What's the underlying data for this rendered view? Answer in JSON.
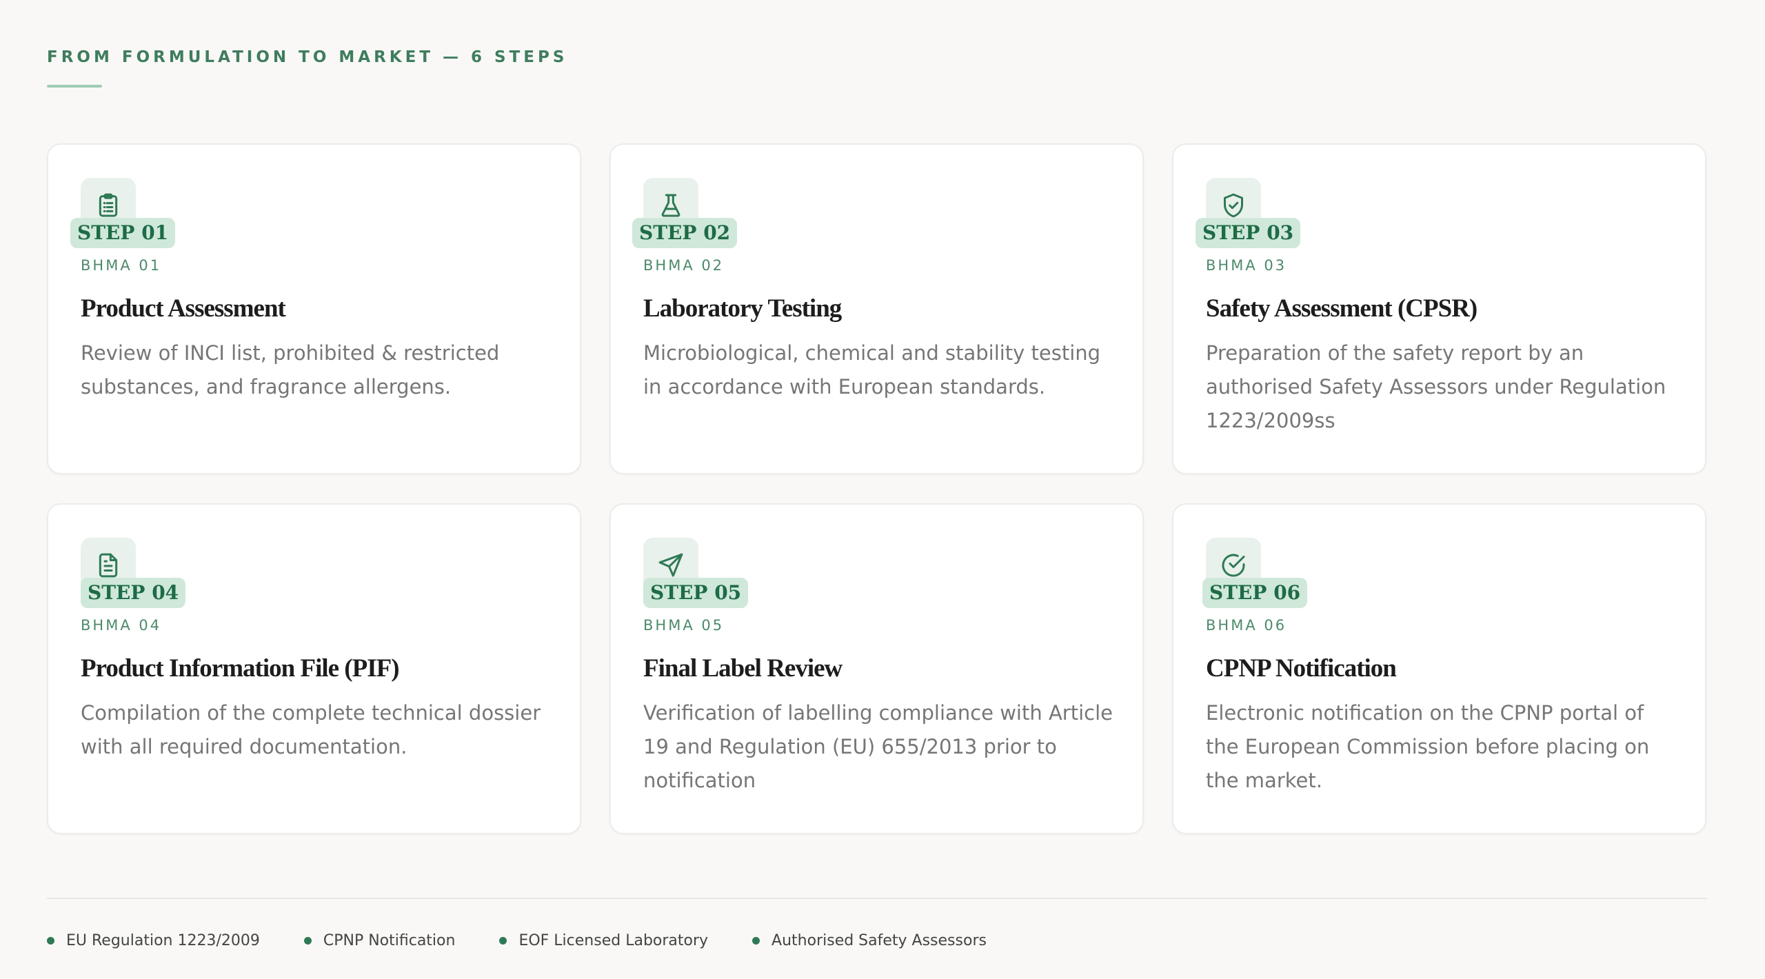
{
  "header": {
    "eyebrow": "FROM FORMULATION TO MARKET — 6 STEPS"
  },
  "colors": {
    "accent": "#2f7a55",
    "badge_bg": "#cfe8da",
    "icon_bg": "#e9f1ec",
    "page_bg": "#f9f8f6"
  },
  "steps": [
    {
      "badge": "STEP 01",
      "code": "BHMA 01",
      "title": "Product Assessment",
      "description": "Review of INCI list, prohibited & restricted substances, and fragrance allergens.",
      "icon": "clipboard-list-icon"
    },
    {
      "badge": "STEP 02",
      "code": "BHMA 02",
      "title": "Laboratory Testing",
      "description": "Microbiological, chemical and stability testing in accordance with European standards.",
      "icon": "flask-icon"
    },
    {
      "badge": "STEP 03",
      "code": "BHMA 03",
      "title": "Safety Assessment (CPSR)",
      "description": "Preparation of the safety report by an authorised Safety Assessors under Regulation 1223/2009ss",
      "icon": "shield-check-icon"
    },
    {
      "badge": "STEP 04",
      "code": "BHMA 04",
      "title": "Product Information File (PIF)",
      "description": "Compilation of the complete technical dossier with all required documentation.",
      "icon": "document-icon"
    },
    {
      "badge": "STEP 05",
      "code": "BHMA 05",
      "title": "Final Label Review",
      "description": "Verification of labelling compliance with Article 19 and Regulation (EU) 655/2013 prior to notification",
      "icon": "send-icon"
    },
    {
      "badge": "STEP 06",
      "code": "BHMA 06",
      "title": "CPNP Notification",
      "description": "Electronic notification on the CPNP portal of the European Commission before placing on the market.",
      "icon": "check-circle-icon"
    }
  ],
  "footer": {
    "items": [
      "EU Regulation 1223/2009",
      "CPNP Notification",
      "EOF Licensed Laboratory",
      "Authorised Safety Assessors"
    ]
  }
}
